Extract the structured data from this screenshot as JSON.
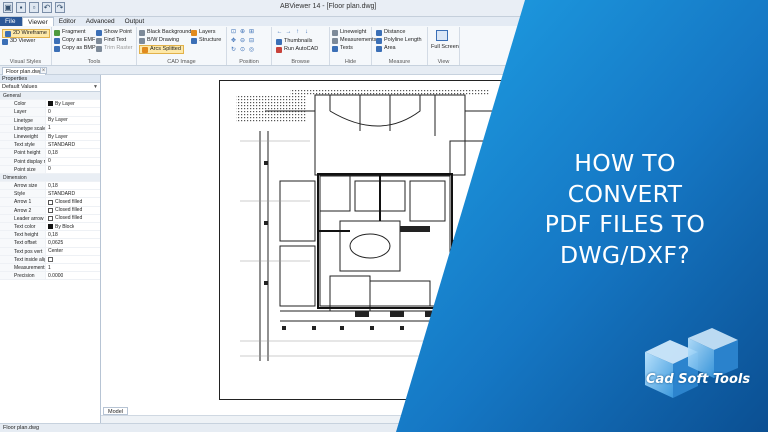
{
  "window": {
    "title": "ABViewer 14 - [Floor plan.dwg]"
  },
  "ribbon_tabs": [
    "File",
    "Viewer",
    "Editor",
    "Advanced",
    "Output"
  ],
  "ribbon": {
    "visual_styles": {
      "label": "Visual Styles",
      "items": [
        "2D Wireframe",
        "3D Viewer"
      ]
    },
    "tools": {
      "label": "Tools",
      "items": [
        "Fragment",
        "Copy as EMF",
        "Copy as BMP",
        "Show Point",
        "Find Text",
        "Trim Raster"
      ]
    },
    "cad_image": {
      "label": "CAD Image",
      "items": [
        "Black Background",
        "B/W Drawing",
        "Arcs Splitted",
        "Layers",
        "Structure"
      ]
    },
    "position": {
      "label": "Position"
    },
    "browse": {
      "label": "Browse",
      "items": [
        "Thumbnails",
        "Run AutoCAD"
      ]
    },
    "hide": {
      "label": "Hide",
      "items": [
        "Lineweight",
        "Measurements",
        "Texts"
      ]
    },
    "measure": {
      "label": "Measure",
      "items": [
        "Distance",
        "Polyline Length",
        "Area"
      ]
    },
    "view": {
      "label": "View",
      "items": [
        "Full Screen"
      ]
    }
  },
  "document_tab": "Floor plan.dwg",
  "properties": {
    "title": "Properties",
    "selector": "Default Values",
    "sections": [
      {
        "name": "General",
        "rows": [
          {
            "key": "Color",
            "value": "By Layer",
            "swatch": "black"
          },
          {
            "key": "Layer",
            "value": "0"
          },
          {
            "key": "Linetype",
            "value": "By Layer"
          },
          {
            "key": "Linetype scale",
            "value": "1"
          },
          {
            "key": "Lineweight",
            "value": "By Layer"
          },
          {
            "key": "Text style",
            "value": "STANDARD"
          },
          {
            "key": "Point height",
            "value": "0,18"
          },
          {
            "key": "Point display m",
            "value": "0"
          },
          {
            "key": "Point size",
            "value": "0"
          }
        ]
      },
      {
        "name": "Dimension",
        "rows": [
          {
            "key": "Arrow size",
            "value": "0,18"
          },
          {
            "key": "Style",
            "value": "STANDARD"
          },
          {
            "key": "Arrow 1",
            "value": "Closed filled",
            "swatch": "white"
          },
          {
            "key": "Arrow 2",
            "value": "Closed filled",
            "swatch": "white"
          },
          {
            "key": "Leader arrow",
            "value": "Closed filled",
            "swatch": "white"
          },
          {
            "key": "Text color",
            "value": "By Block",
            "swatch": "black"
          },
          {
            "key": "Text height",
            "value": "0,18"
          },
          {
            "key": "Text offset",
            "value": "0,0625"
          },
          {
            "key": "Text pos vert",
            "value": "Center"
          },
          {
            "key": "Text inside alig",
            "value": "",
            "checkbox": true
          },
          {
            "key": "Measurements",
            "value": "1"
          },
          {
            "key": "Precision",
            "value": "0.0000"
          }
        ]
      }
    ]
  },
  "layout_tab": "Model",
  "status_bar": "Floor plan.dwg",
  "promo": {
    "headline": [
      "HOW TO",
      "CONVERT",
      "PDF FILES TO",
      "DWG/DXF?"
    ],
    "logo": "Cad Soft Tools"
  },
  "colors": {
    "promo_gradient_start": "#1a9be0",
    "promo_gradient_end": "#0b4f92",
    "ribbon_file_tab": "#2b5797",
    "highlight": "#fde8a8"
  }
}
